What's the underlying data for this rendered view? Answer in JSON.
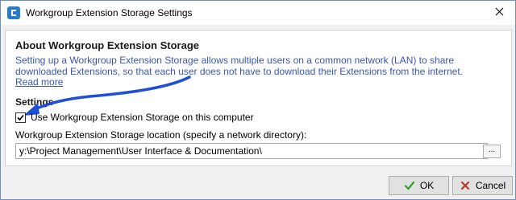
{
  "window": {
    "title": "Workgroup Extension Storage Settings"
  },
  "about": {
    "title": "About Workgroup Extension Storage",
    "description": "Setting up a Workgroup Extension Storage allows multiple users on a common network (LAN) to share downloaded Extensions, so that each user does not have to download their Extensions from the internet.",
    "read_more": "Read more"
  },
  "settings": {
    "title": "Settings",
    "use_storage_label": "Use Workgroup Extension Storage on this computer",
    "use_storage_checked": true,
    "location_label": "Workgroup Extension Storage location (specify a network directory):",
    "location_value": "y:\\Project Management\\User Interface & Documentation\\",
    "browse_label": "..."
  },
  "buttons": {
    "ok_label": "OK",
    "cancel_label": "Cancel"
  },
  "icons": {
    "app": "app-logo-icon",
    "close": "close-icon",
    "ok": "green-check-icon",
    "cancel": "red-x-icon",
    "annotation": "blue-arrow-annotation"
  },
  "colors": {
    "link": "#3a56b5",
    "arrow": "#1f4fd6",
    "ok_icon": "#2aa32a",
    "cancel_icon": "#c0392b"
  }
}
